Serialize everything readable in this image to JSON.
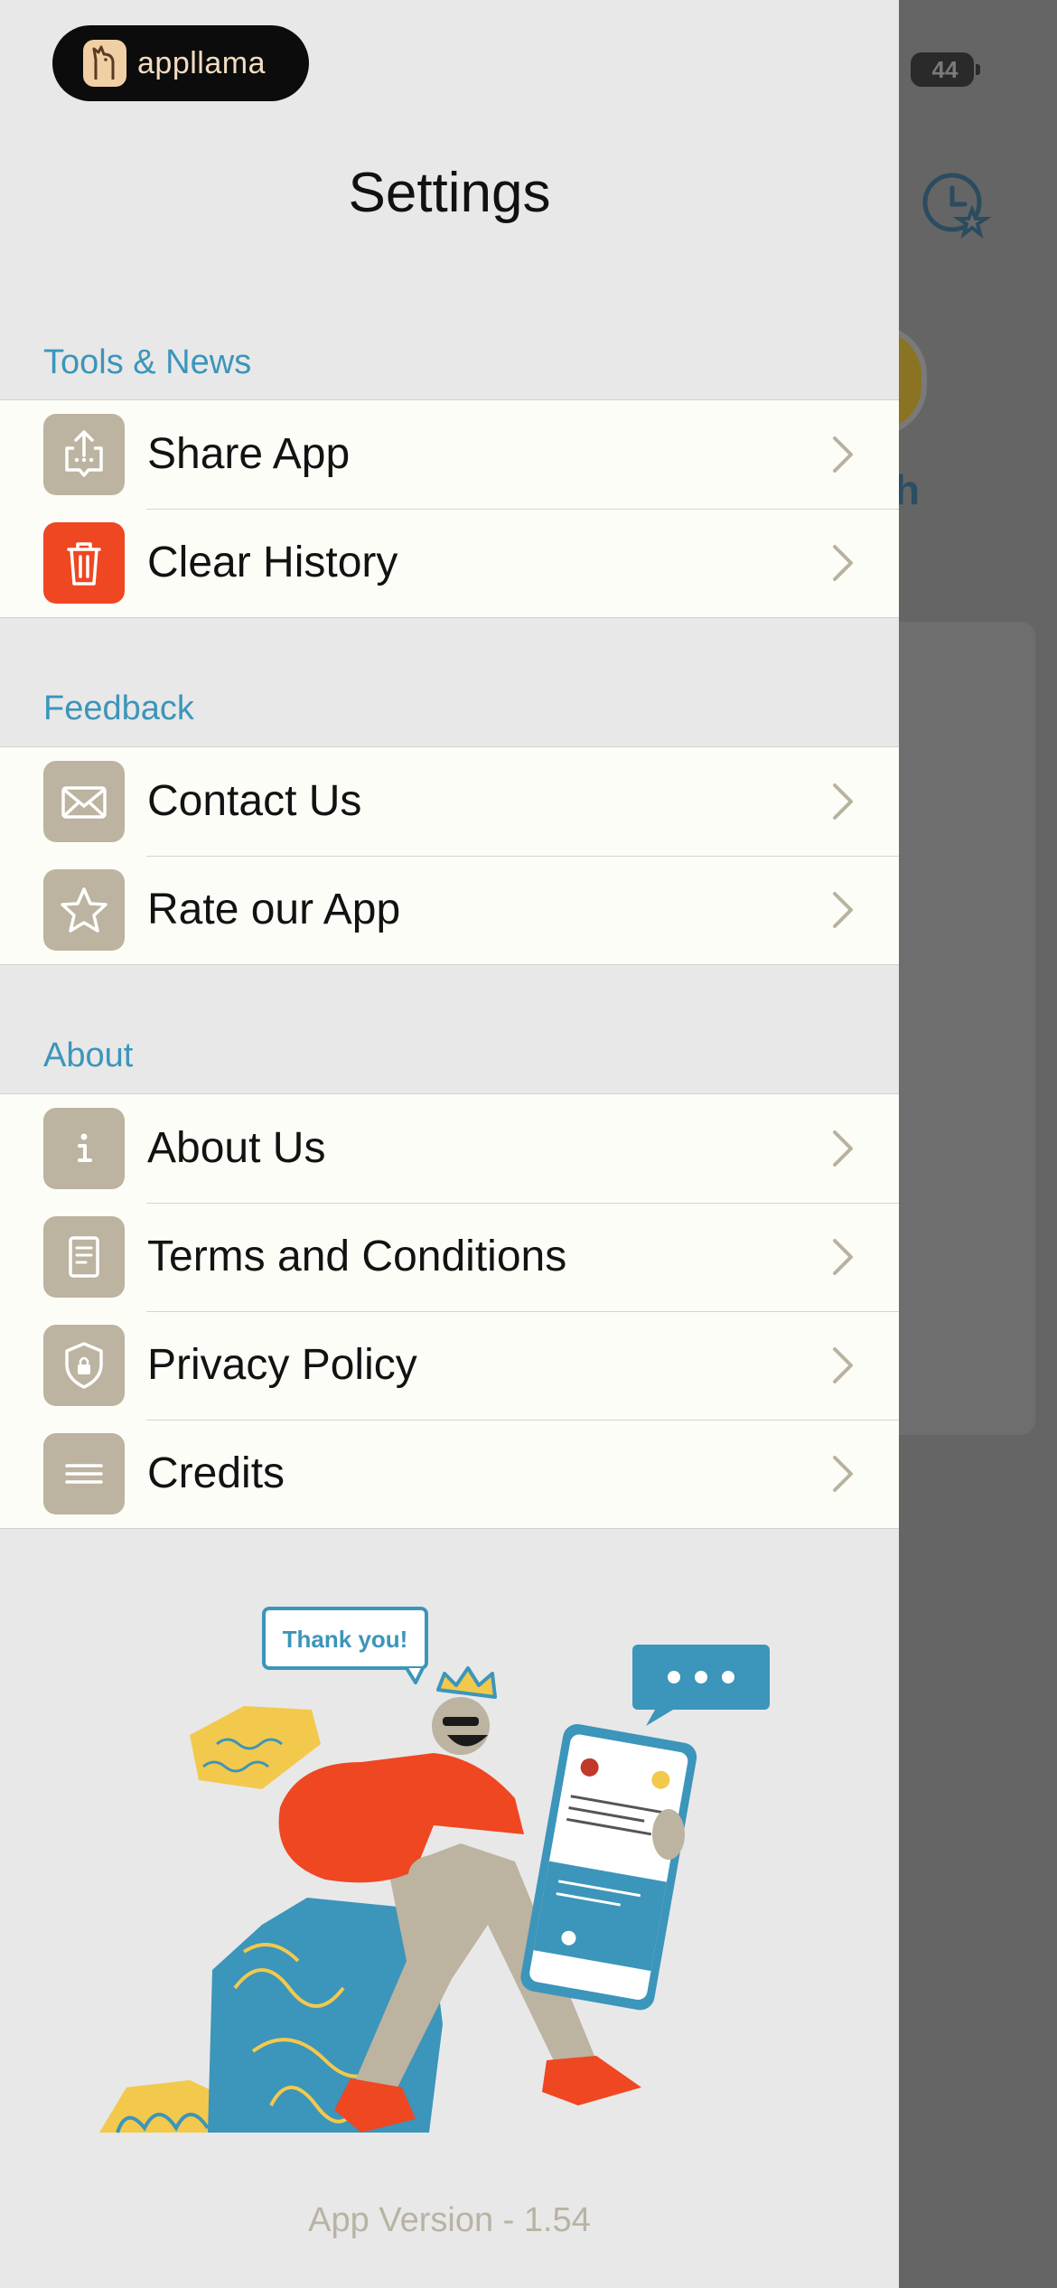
{
  "status_bar": {
    "battery_level": "44"
  },
  "brand": {
    "name": "appllama"
  },
  "header": {
    "title": "Settings"
  },
  "sections": [
    {
      "label": "Tools & News",
      "items": [
        {
          "label": "Share App",
          "icon": "share-icon"
        },
        {
          "label": "Clear History",
          "icon": "trash-icon",
          "accent": "#ee4722"
        }
      ]
    },
    {
      "label": "Feedback",
      "items": [
        {
          "label": "Contact Us",
          "icon": "mail-icon"
        },
        {
          "label": "Rate our App",
          "icon": "star-icon"
        }
      ]
    },
    {
      "label": "About",
      "items": [
        {
          "label": "About Us",
          "icon": "info-icon"
        },
        {
          "label": "Terms and Conditions",
          "icon": "document-icon"
        },
        {
          "label": "Privacy Policy",
          "icon": "lock-shield-icon"
        },
        {
          "label": "Credits",
          "icon": "list-icon"
        }
      ]
    }
  ],
  "illustration": {
    "speech_bubble": "Thank you!"
  },
  "footer": {
    "version": "App Version - 1.54"
  },
  "background": {
    "partial_letter": "h"
  },
  "colors": {
    "section_label": "#3c95ba",
    "icon_bg": "#bcb3a0",
    "destructive": "#ee4722"
  }
}
